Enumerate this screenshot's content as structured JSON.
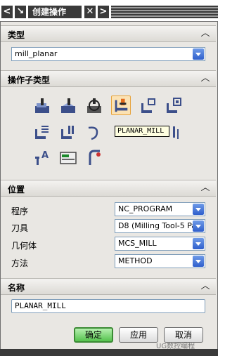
{
  "title_bar": {
    "back_glyph": "<",
    "pin_glyph": "↘",
    "title": "创建操作",
    "close_glyph": "✕",
    "forward_glyph": ">"
  },
  "sections": {
    "type": {
      "label": "类型",
      "collapse_glyph": "︿"
    },
    "subtype": {
      "label": "操作子类型",
      "collapse_glyph": "︿"
    },
    "location": {
      "label": "位置",
      "collapse_glyph": "︿"
    },
    "name": {
      "label": "名称",
      "collapse_glyph": "︿"
    }
  },
  "type_dropdown": {
    "value": "mill_planar"
  },
  "subtype_icons": [
    {
      "name": "face-milling-area-icon"
    },
    {
      "name": "face-milling-icon"
    },
    {
      "name": "face-milling-manual-icon"
    },
    {
      "name": "planar-mill-icon",
      "selected": true
    },
    {
      "name": "planar-profile-icon"
    },
    {
      "name": "clean-up-corners-icon"
    },
    {
      "name": "finish-walls-icon"
    },
    {
      "name": "finish-floor-icon"
    },
    {
      "name": "hole-milling-icon"
    },
    {
      "name": "thread-milling-icon"
    },
    {
      "name": "planar-text-icon"
    },
    {
      "name": "mill-control-icon"
    },
    {
      "name": "mill-user-icon"
    }
  ],
  "tooltip": {
    "text": "PLANAR_MILL"
  },
  "location_rows": [
    {
      "label": "程序",
      "value": "NC_PROGRAM"
    },
    {
      "label": "刀具",
      "value": "D8 (Milling Tool-5 Pa"
    },
    {
      "label": "几何体",
      "value": "MCS_MILL"
    },
    {
      "label": "方法",
      "value": "METHOD"
    }
  ],
  "name_field": {
    "value": "PLANAR_MILL"
  },
  "buttons": {
    "ok": "确定",
    "apply": "应用",
    "cancel": "取消"
  },
  "watermark": "UG数控编程",
  "colors": {
    "accent_blue": "#2f5fcc",
    "ok_green": "#55c24d",
    "selection_orange": "#e7a33c"
  }
}
